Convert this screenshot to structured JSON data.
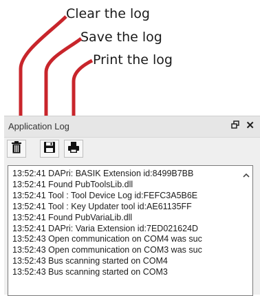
{
  "callouts": {
    "clear": "Clear the log",
    "save": "Save the log",
    "print": "Print the log"
  },
  "panel": {
    "title": "Application Log",
    "float_icon": "float-window-icon",
    "close_icon": "close-icon"
  },
  "toolbar": {
    "buttons": [
      {
        "name": "clear",
        "icon": "trash-icon"
      },
      {
        "name": "save",
        "icon": "floppy-disk-icon"
      },
      {
        "name": "print",
        "icon": "printer-icon"
      }
    ]
  },
  "log": {
    "lines": [
      "13:52:41  DAPri: BASIK  Extension id:8499B7BB",
      "13:52:41 Found PubToolsLib.dll",
      "13:52:41  Tool : Tool Device Log id:FEFC3A5B6E",
      "13:52:41  Tool : Key Updater tool id:AE61135FF",
      "13:52:41 Found PubVariaLib.dll",
      "13:52:41  DAPri: Varia Extension id:7ED021624D",
      "13:52:43 Open communication on COM4 was suc",
      "13:52:43 Open communication on COM3 was suc",
      "13:52:43 Bus scanning started on COM4",
      "13:52:43 Bus scanning started on COM3"
    ]
  },
  "colors": {
    "arrow": "#c8252b",
    "text": "#1a1a1a"
  }
}
